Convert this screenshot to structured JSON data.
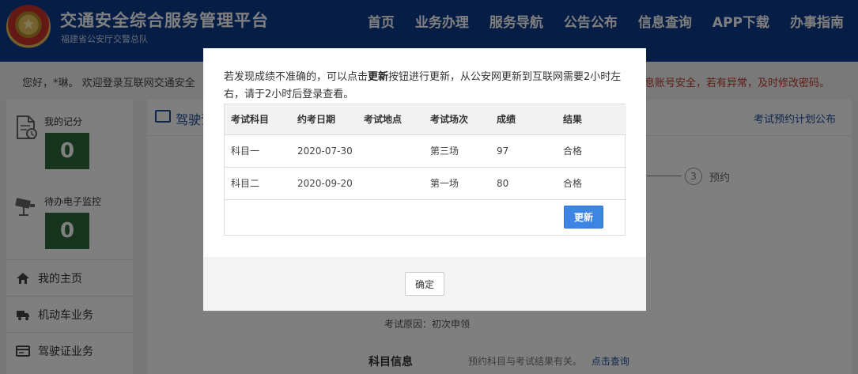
{
  "header": {
    "title": "交通安全综合服务管理平台",
    "subtitle": "福建省公安厅交警总队",
    "nav": [
      "首页",
      "业务办理",
      "服务导航",
      "公告公布",
      "信息查询",
      "APP下载",
      "办事指南"
    ]
  },
  "notice": {
    "left": "您好，*琳。 欢迎登录互联网交通安全",
    "right": "息账号安全，若有异常，及时修改密码。"
  },
  "sidebar": {
    "points_label": "我的记分",
    "points_value": "0",
    "monitor_label": "待办电子监控",
    "monitor_value": "0",
    "menu": [
      {
        "label": "我的主页",
        "icon": "home-icon"
      },
      {
        "label": "机动车业务",
        "icon": "truck-icon"
      },
      {
        "label": "驾驶证业务",
        "icon": "id-card-icon"
      }
    ]
  },
  "main": {
    "title": "驾驶证",
    "header_link": "考试预约计划公布",
    "step_number": "3",
    "step_label": "预约",
    "exam_reason": "考试原因：初次申领",
    "subject_title": "科目信息",
    "subject_note": "预约科目与考试结果有关。",
    "subject_link": "点击查询"
  },
  "modal": {
    "message_pre": "若发现成绩不准确的，可以点击",
    "message_bold": "更新",
    "message_post": "按钮进行更新，从公安网更新到互联网需要2小时左右，请于2小时后登录查看。",
    "columns": [
      "考试科目",
      "约考日期",
      "考试地点",
      "考试场次",
      "成绩",
      "结果"
    ],
    "rows": [
      [
        "科目一",
        "2020-07-30",
        "",
        "第三场",
        "97",
        "合格"
      ],
      [
        "科目二",
        "2020-09-20",
        "",
        "第一场",
        "80",
        "合格"
      ]
    ],
    "update_label": "更新",
    "ok_label": "确定"
  },
  "colors": {
    "header_bg": "#0c3a8c",
    "primary_button": "#3c85e2",
    "counter_bg": "#2e6b3a",
    "link": "#1d4b9c"
  }
}
